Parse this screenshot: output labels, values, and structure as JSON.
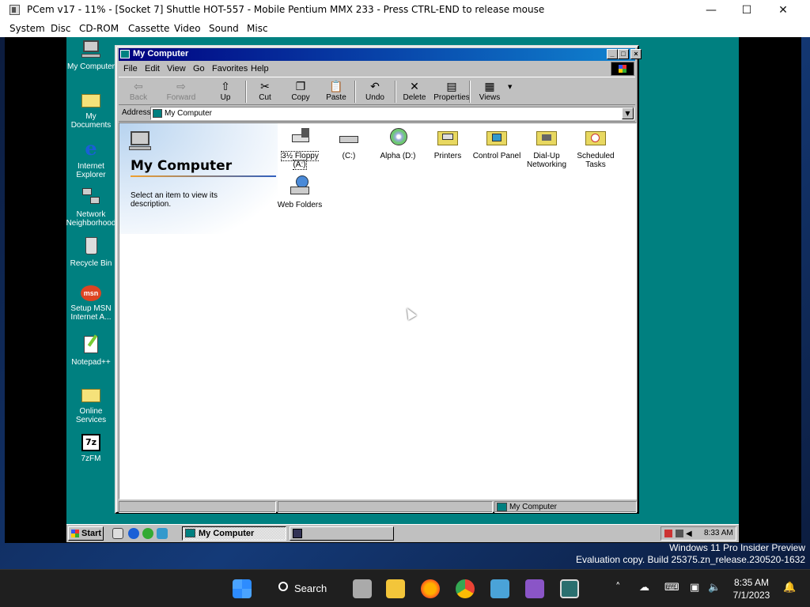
{
  "host": {
    "title": "PCem v17 - 11% - [Socket 7] Shuttle HOT-557 - Mobile Pentium MMX 233 - Press CTRL-END to release mouse",
    "menu": [
      "System",
      "Disc",
      "CD-ROM",
      "Cassette",
      "Video",
      "Sound",
      "Misc"
    ],
    "controls": {
      "minimize": "—",
      "maximize": "☐",
      "close": "✕"
    }
  },
  "desktop_icons": [
    {
      "label": "My Computer",
      "icon": "computer-icon"
    },
    {
      "label": "My Documents",
      "icon": "folder-icon"
    },
    {
      "label": "Internet Explorer",
      "icon": "ie-icon"
    },
    {
      "label": "Network Neighborhood",
      "icon": "network-icon"
    },
    {
      "label": "Recycle Bin",
      "icon": "recycle-bin-icon"
    },
    {
      "label": "Setup MSN Internet A...",
      "icon": "msn-icon"
    },
    {
      "label": "Notepad++",
      "icon": "notepad-icon"
    },
    {
      "label": "Online Services",
      "icon": "folder-icon"
    },
    {
      "label": "7zFM",
      "icon": "7zip-icon"
    }
  ],
  "explorer": {
    "title": "My Computer",
    "menu": [
      "File",
      "Edit",
      "View",
      "Go",
      "Favorites",
      "Help"
    ],
    "toolbar": [
      {
        "label": "Back",
        "icon": "back-icon",
        "enabled": false
      },
      {
        "label": "Forward",
        "icon": "forward-icon",
        "enabled": false
      },
      {
        "label": "Up",
        "icon": "up-icon",
        "enabled": true
      },
      {
        "label": "Cut",
        "icon": "cut-icon",
        "enabled": true
      },
      {
        "label": "Copy",
        "icon": "copy-icon",
        "enabled": true
      },
      {
        "label": "Paste",
        "icon": "paste-icon",
        "enabled": true
      },
      {
        "label": "Undo",
        "icon": "undo-icon",
        "enabled": true
      },
      {
        "label": "Delete",
        "icon": "delete-icon",
        "enabled": true
      },
      {
        "label": "Properties",
        "icon": "properties-icon",
        "enabled": true
      },
      {
        "label": "Views",
        "icon": "views-icon",
        "enabled": true
      }
    ],
    "address_label": "Address",
    "address_value": "My Computer",
    "webview": {
      "title": "My Computer",
      "description": "Select an item to view its description."
    },
    "items": [
      {
        "label": "3½ Floppy (A:)",
        "icon": "floppy-drive-icon"
      },
      {
        "label": "(C:)",
        "icon": "hard-drive-icon"
      },
      {
        "label": "Alpha (D:)",
        "icon": "cdrom-drive-icon"
      },
      {
        "label": "Printers",
        "icon": "printers-folder-icon"
      },
      {
        "label": "Control Panel",
        "icon": "control-panel-icon"
      },
      {
        "label": "Dial-Up Networking",
        "icon": "dialup-networking-icon"
      },
      {
        "label": "Scheduled Tasks",
        "icon": "scheduled-tasks-icon"
      },
      {
        "label": "Web Folders",
        "icon": "web-folders-icon"
      }
    ],
    "status": {
      "zone": "My Computer"
    }
  },
  "w98_taskbar": {
    "start": "Start",
    "tasks": [
      {
        "label": "My Computer"
      },
      {
        "label": ""
      }
    ],
    "clock": "8:33 AM"
  },
  "watermark": {
    "line1": "Windows 11 Pro Insider Preview",
    "line2": "Evaluation copy. Build 25375.zn_release.230520-1632"
  },
  "w11_taskbar": {
    "search": "Search",
    "time": "8:35 AM",
    "date": "7/1/2023"
  },
  "colors": {
    "teal": "#008080",
    "title_blue": "#000080",
    "face": "#c0c0c0"
  }
}
